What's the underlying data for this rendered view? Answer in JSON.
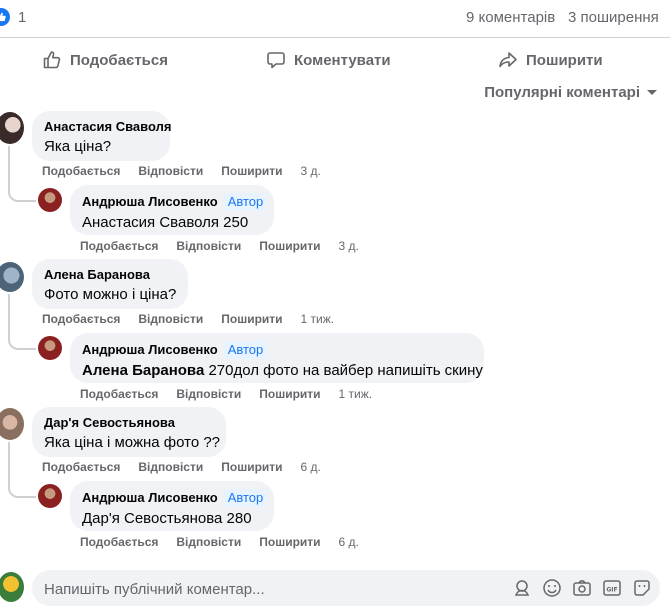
{
  "stats": {
    "likes": "1",
    "comments": "9 коментарів",
    "shares": "3 поширення"
  },
  "actions": {
    "like": "Подобається",
    "comment": "Коментувати",
    "share": "Поширити"
  },
  "sort_label": "Популярні коментарі",
  "comments": [
    {
      "author": "Анастасия Сваволя",
      "text": "Яка ціна?",
      "meta": {
        "like": "Подобається",
        "reply": "Відповісти",
        "share": "Поширити",
        "time": "3 д."
      },
      "reply": {
        "author": "Андрюша Лисовенко",
        "badge": "Автор",
        "mention": "",
        "text": "Анастасия Сваволя 250",
        "meta": {
          "like": "Подобається",
          "reply": "Відповісти",
          "share": "Поширити",
          "time": "3 д."
        }
      }
    },
    {
      "author": "Алена Баранова",
      "text": "Фото можно і ціна?",
      "meta": {
        "like": "Подобається",
        "reply": "Відповісти",
        "share": "Поширити",
        "time": "1 тиж."
      },
      "reply": {
        "author": "Андрюша Лисовенко",
        "badge": "Автор",
        "mention": "Алена Баранова",
        "text": " 270дол фото на вайбер напишіть скину",
        "meta": {
          "like": "Подобається",
          "reply": "Відповісти",
          "share": "Поширити",
          "time": "1 тиж."
        }
      }
    },
    {
      "author": "Дар'я Севостьянова",
      "text": "Яка ціна і можна фото ??",
      "meta": {
        "like": "Подобається",
        "reply": "Відповісти",
        "share": "Поширити",
        "time": "6 д."
      },
      "reply": {
        "author": "Андрюша Лисовенко",
        "badge": "Автор",
        "mention": "",
        "text": "Дар'я Севостьянова 280",
        "meta": {
          "like": "Подобається",
          "reply": "Відповісти",
          "share": "Поширити",
          "time": "6 д."
        }
      }
    }
  ],
  "composer": {
    "placeholder": "Напишіть публічний коментар..."
  },
  "colors": {
    "accent": "#1877f2",
    "secondary_text": "#65676b",
    "bubble": "#f0f2f5"
  }
}
